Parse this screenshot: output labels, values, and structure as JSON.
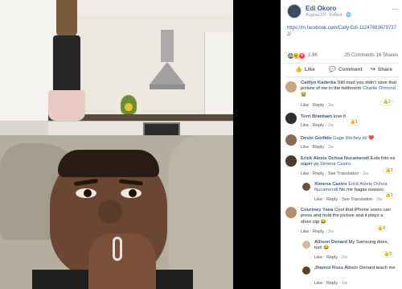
{
  "post": {
    "author": "Edi Okoro",
    "meta": "August 20 · Edited · ",
    "link": "https://m.facebook.com/Cally-Edi-112476636797372/",
    "more_label": "···",
    "reactions_count": "1.9K",
    "comments_count": "25 Comments",
    "shares_count": "16 Shares"
  },
  "actions": {
    "like": "Like",
    "comment": "Comment",
    "share": "Share"
  },
  "comments": [
    {
      "name": "Caitlyn Kaderka",
      "text": "Still mad you didn't save that picture of me in the bathroom",
      "tag": "Charlie Ormond",
      "emoji": "😭",
      "like": "Like",
      "reply": "Reply",
      "time": "3w",
      "reaction_count": "2"
    },
    {
      "name": "Terri Branham",
      "text": "love it",
      "like": "Like",
      "reply": "Reply",
      "time": "2w",
      "reaction_count": "1"
    },
    {
      "name": "Devin Gorfido",
      "text": "Gage Ritchey lol ❤️",
      "like": "Like",
      "reply": "Reply",
      "time": "2w"
    },
    {
      "name": "Erick Alexis Ochoa Nucamendi",
      "text": "Esta foto es súper yo",
      "tag": "Ximena Castro",
      "like": "Like",
      "reply": "Reply",
      "see_translation": "See Translation",
      "time": "2w",
      "reaction_count": "1"
    },
    {
      "name": "Ximena Castro",
      "text": "No me hagas essooo",
      "tag": "Erick Alexis Ochoa Nucamendi",
      "like": "Like",
      "reply": "Reply",
      "see_translation": "See Translation",
      "time": "2w",
      "reaction_count": "1"
    },
    {
      "name": "Courtney Yana",
      "text": "Cool that iPhone users can press and hold the picture and it plays a short clip",
      "emoji": "😂",
      "like": "Like",
      "reply": "Reply",
      "time": "2w",
      "reaction_count": "4"
    },
    {
      "name": "Allison Denard",
      "text": "My Samsung does, too!",
      "emoji": "😂",
      "like": "Like",
      "reply": "Reply",
      "time": "2w",
      "reaction_count": "3"
    },
    {
      "name": "Jhamol Ross",
      "text": "Allison Denard teach me",
      "like": "Like",
      "reply": "Reply",
      "time": "1w"
    }
  ],
  "colors": {
    "link_blue": "#385898",
    "like_blue": "#1877f2",
    "love_red": "#f33e58",
    "haha_yellow": "#f7b125"
  }
}
